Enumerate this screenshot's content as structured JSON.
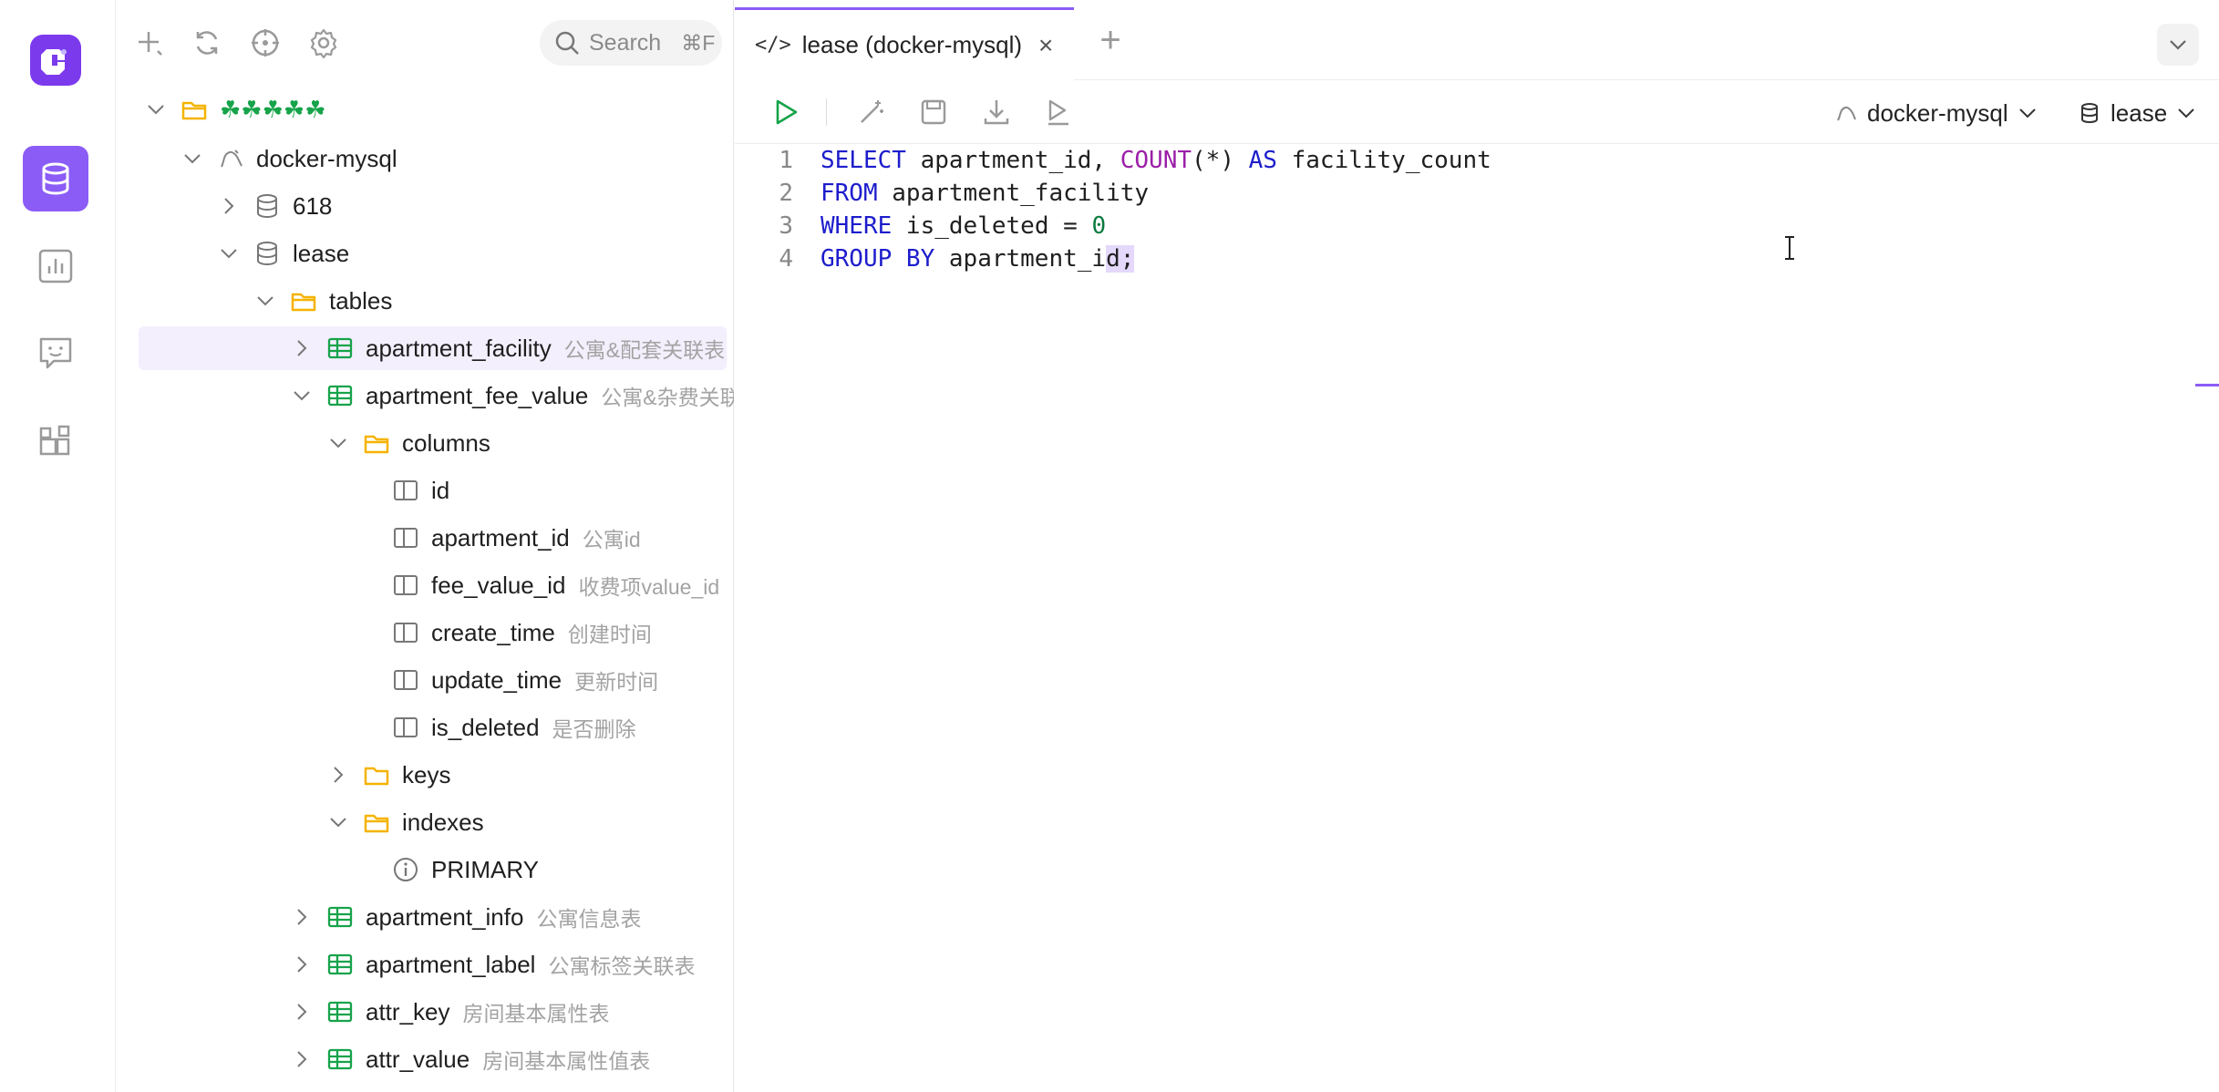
{
  "toolbar": {
    "search_placeholder": "Search",
    "search_shortcut": "⌘F"
  },
  "tree": {
    "root": "☘☘☘☘☘",
    "connection": "docker-mysql",
    "db_618": "618",
    "db_lease": "lease",
    "tables_folder": "tables",
    "t_apartment_facility": "apartment_facility",
    "t_apartment_facility_comment": "公寓&配套关联表",
    "t_apartment_fee_value": "apartment_fee_value",
    "t_apartment_fee_value_comment": "公寓&杂费关联",
    "columns_folder": "columns",
    "c_id": "id",
    "c_apartment_id": "apartment_id",
    "c_apartment_id_comment": "公寓id",
    "c_fee_value_id": "fee_value_id",
    "c_fee_value_id_comment": "收费项value_id",
    "c_create_time": "create_time",
    "c_create_time_comment": "创建时间",
    "c_update_time": "update_time",
    "c_update_time_comment": "更新时间",
    "c_is_deleted": "is_deleted",
    "c_is_deleted_comment": "是否删除",
    "keys_folder": "keys",
    "indexes_folder": "indexes",
    "i_primary": "PRIMARY",
    "t_apartment_info": "apartment_info",
    "t_apartment_info_comment": "公寓信息表",
    "t_apartment_label": "apartment_label",
    "t_apartment_label_comment": "公寓标签关联表",
    "t_attr_key": "attr_key",
    "t_attr_key_comment": "房间基本属性表",
    "t_attr_value": "attr_value",
    "t_attr_value_comment": "房间基本属性值表"
  },
  "tab": {
    "icon": "</>",
    "label": "lease (docker-mysql)",
    "close": "×",
    "add": "+"
  },
  "actions": {
    "connection_select": "docker-mysql",
    "database_select": "lease"
  },
  "editor": {
    "line_numbers": [
      "1",
      "2",
      "3",
      "4"
    ],
    "l1_kw1": "SELECT",
    "l1_t1": " apartment_id, ",
    "l1_fn": "COUNT",
    "l1_t2": "(*) ",
    "l1_kw2": "AS",
    "l1_t3": " facility_count",
    "l2_kw": "FROM",
    "l2_t": " apartment_facility",
    "l3_kw": "WHERE",
    "l3_t": " is_deleted = ",
    "l3_num": "0",
    "l4_kw": "GROUP BY",
    "l4_t": " apartment_i",
    "l4_hl": "d;"
  },
  "colors": {
    "accent": "#8b5cf6",
    "logo": "#7c3aed",
    "keyword": "#1d1dcc",
    "function": "#9b1fa8",
    "number": "#0a7a3e",
    "table_icon": "#16a34a",
    "folder_icon": "#f5b301"
  }
}
